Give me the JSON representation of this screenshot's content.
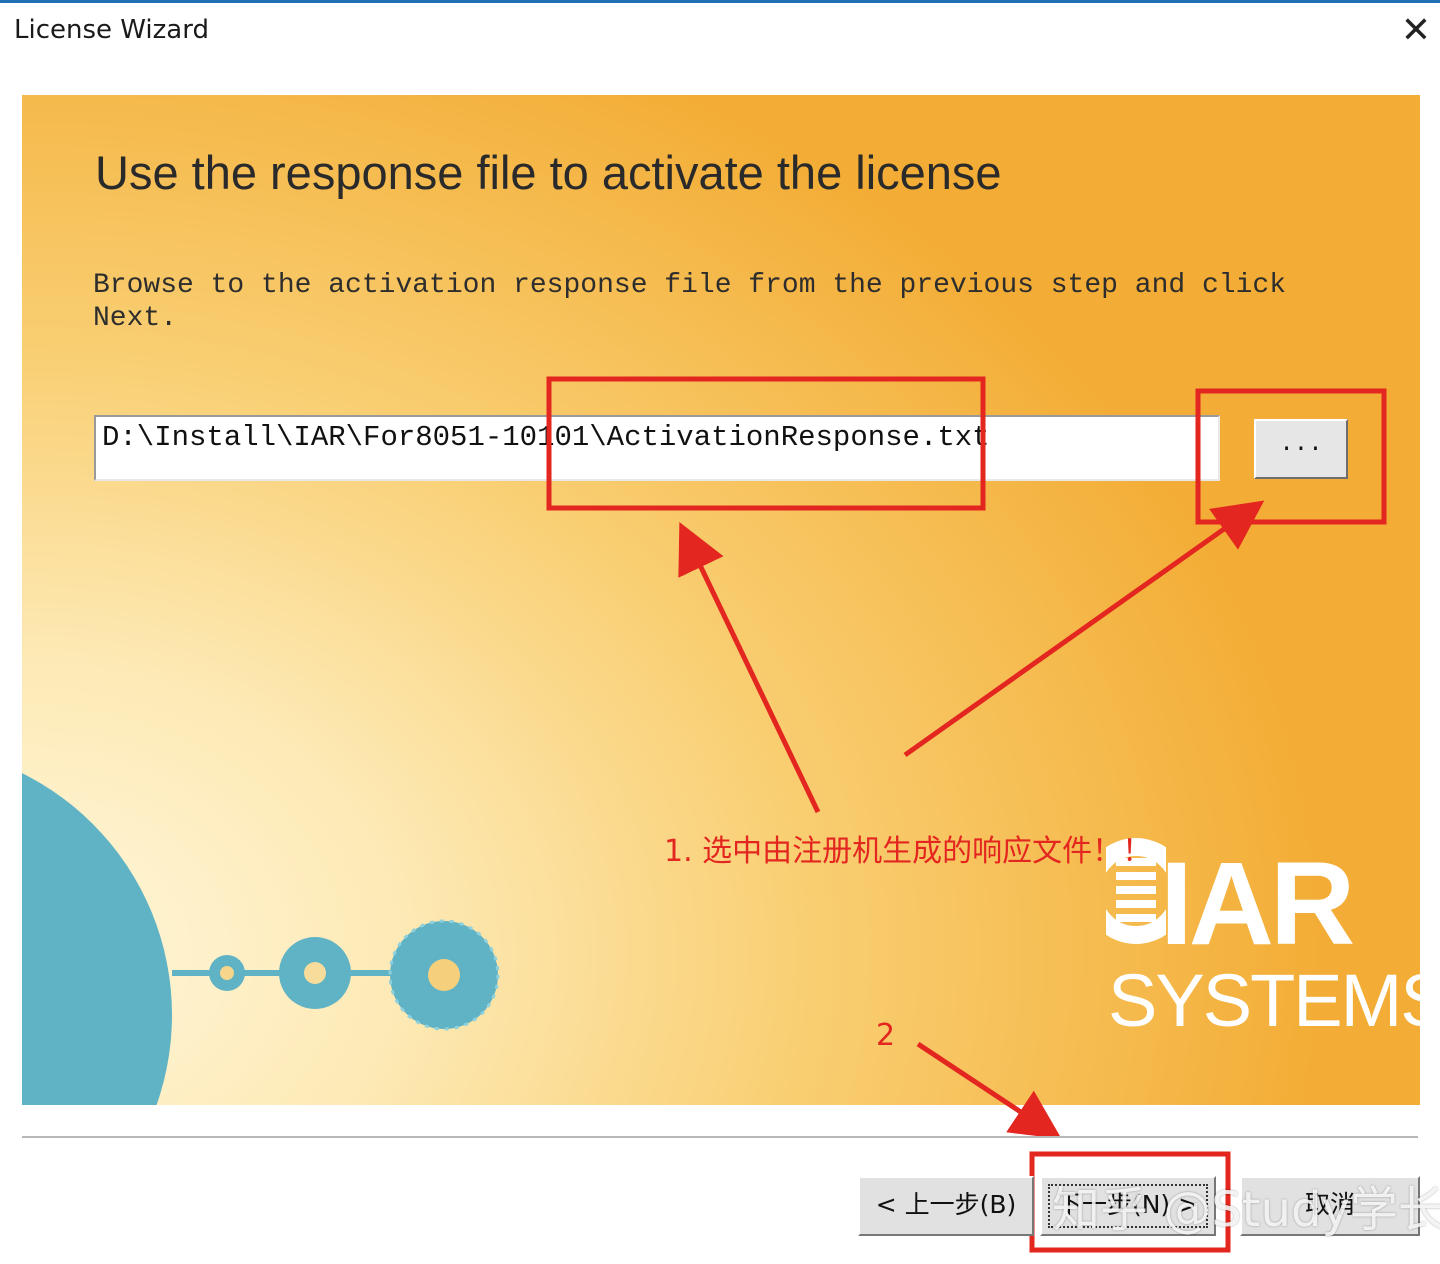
{
  "window": {
    "title": "License Wizard",
    "close_glyph": "✕"
  },
  "wizard": {
    "heading": "Use the response file to activate the license",
    "description": "Browse to the activation response file from the previous step and click Next.",
    "file_path": "D:\\Install\\IAR\\For8051-10101\\ActivationResponse.txt",
    "browse_label": "..."
  },
  "annotations": {
    "step1": "1. 选中由注册机生成的响应文件！！",
    "step2": "2",
    "color": "#e3261f"
  },
  "branding": {
    "logo_text": "IAR",
    "logo_subtext": "SYSTEMS"
  },
  "buttons": {
    "back": "< 上一步(B)",
    "next": "下一步(N) >",
    "cancel": "取消"
  },
  "watermark": "知乎 @Study学长",
  "colors": {
    "titlebar_accent": "#1f6fb5",
    "panel_gradient_start": "#fff7dc",
    "panel_gradient_end": "#f3ad36",
    "disc_color": "#5fb3c5"
  },
  "icons": {
    "close": "close-icon",
    "logo": "iar-logo-icon",
    "discs": "disc-decoration-icon"
  }
}
